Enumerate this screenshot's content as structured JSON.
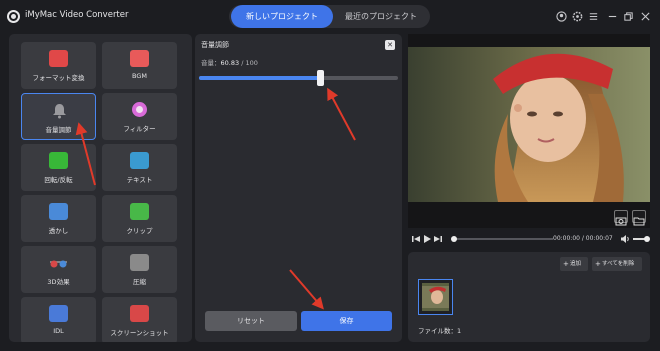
{
  "app": {
    "title": "iMyMac Video Converter"
  },
  "tabs": [
    {
      "label": "新しいプロジェクト",
      "active": true
    },
    {
      "label": "最近のプロジェクト",
      "active": false
    }
  ],
  "window_controls": [
    "user-icon",
    "settings-icon",
    "menu-icon",
    "minimize-icon",
    "restore-icon",
    "close-icon"
  ],
  "tools": [
    {
      "label": "フォーマット変換",
      "icon": "format-convert-icon",
      "color": "#e04848"
    },
    {
      "label": "BGM",
      "icon": "bgm-icon",
      "color": "#e85a5a"
    },
    {
      "label": "音量調節",
      "icon": "volume-bell-icon",
      "color": "#8a8a8a",
      "active": true
    },
    {
      "label": "フィルター",
      "icon": "filter-icon",
      "color": "#d86ad8"
    },
    {
      "label": "回転/反転",
      "icon": "rotate-flip-icon",
      "color": "#38b838"
    },
    {
      "label": "テキスト",
      "icon": "text-icon",
      "color": "#3a9ad0"
    },
    {
      "label": "透かし",
      "icon": "watermark-icon",
      "color": "#4a8ad8"
    },
    {
      "label": "クリップ",
      "icon": "clip-icon",
      "color": "#48b848"
    },
    {
      "label": "3D効果",
      "icon": "3d-glasses-icon",
      "color": "#7a7a7a"
    },
    {
      "label": "圧縮",
      "icon": "compress-icon",
      "color": "#8a8a8a"
    },
    {
      "label": "IDL",
      "icon": "id3-icon",
      "color": "#4a7ad8"
    },
    {
      "label": "スクリーンショット",
      "icon": "screenshot-icon",
      "color": "#d84848"
    }
  ],
  "volume": {
    "title": "音量調節",
    "label_prefix": "音量：",
    "value": "60.83",
    "max": "/ 100",
    "level": 60.83,
    "close_icon": "close-icon"
  },
  "buttons": {
    "reset": "リセット",
    "save": "保存"
  },
  "video": {
    "snapshot_icon": "camera-icon",
    "folder_icon": "folder-icon"
  },
  "player": {
    "time": "00:00:00 / 00:00:07",
    "progress": 0
  },
  "media": {
    "add_label": "追加",
    "delete_all_label": "すべてを削除",
    "file_count": "ファイル数：1"
  },
  "colors": {
    "accent": "#3f74e8",
    "annotation": "#e03a2a"
  }
}
